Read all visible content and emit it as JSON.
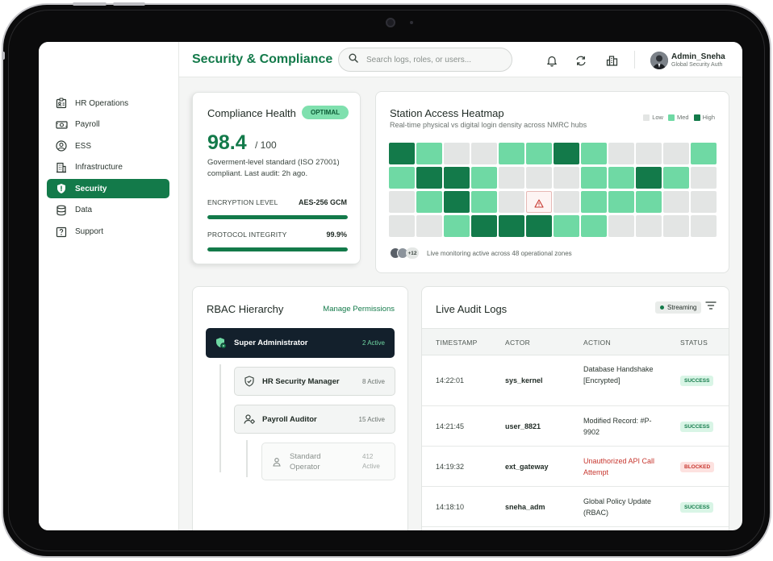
{
  "app": {
    "page_title": "Security & Compliance",
    "search_placeholder": "Search logs, roles, or users...",
    "user": {
      "name": "Admin_Sneha",
      "role": "Global Security Auth"
    }
  },
  "sidebar": {
    "items": [
      {
        "label": "HR Operations",
        "icon": "id-card-icon",
        "active": false
      },
      {
        "label": "Payroll",
        "icon": "money-icon",
        "active": false
      },
      {
        "label": "ESS",
        "icon": "user-circle-icon",
        "active": false
      },
      {
        "label": "Infrastructure",
        "icon": "building-icon",
        "active": false
      },
      {
        "label": "Security",
        "icon": "shield-icon",
        "active": true
      },
      {
        "label": "Data",
        "icon": "database-icon",
        "active": false
      },
      {
        "label": "Support",
        "icon": "help-icon",
        "active": false
      }
    ]
  },
  "header_icons": [
    "bell-icon",
    "sync-icon",
    "buildings-icon"
  ],
  "compliance": {
    "title": "Compliance Health",
    "badge": "OPTIMAL",
    "score": "98.4",
    "score_denominator": "/ 100",
    "description": "Goverment-level standard (ISO 27001) compliant. Last audit: 2h ago.",
    "metrics": [
      {
        "label": "ENCRYPTION LEVEL",
        "value": "AES-256 GCM",
        "fill": 1.0
      },
      {
        "label": "PROTOCOL INTEGRITY",
        "value": "99.9%",
        "fill": 0.999
      }
    ]
  },
  "heatmap": {
    "title": "Station Access Heatmap",
    "subtitle": "Real-time physical vs digital login density across NMRC hubs",
    "legend": [
      {
        "label": "Low",
        "color": "#e3e5e4"
      },
      {
        "label": "Med",
        "color": "#6fd9a4"
      },
      {
        "label": "High",
        "color": "#137a4a"
      }
    ],
    "levels": [
      [
        3,
        2,
        1,
        1,
        2,
        2,
        3,
        2,
        1,
        1,
        1,
        2
      ],
      [
        2,
        3,
        3,
        2,
        1,
        1,
        1,
        2,
        2,
        3,
        2,
        1
      ],
      [
        1,
        2,
        3,
        2,
        1,
        0,
        1,
        2,
        2,
        2,
        1,
        1
      ],
      [
        1,
        1,
        2,
        3,
        3,
        3,
        2,
        2,
        1,
        1,
        1,
        1
      ]
    ],
    "alert_icon": "warning-icon",
    "footer_count": "+12",
    "footer_text": "Live monitoring active across 48 operational zones"
  },
  "rbac": {
    "title": "RBAC Hierarchy",
    "manage_link": "Manage Permissions",
    "roles": [
      {
        "name": "Super Administrator",
        "count": "2 Active",
        "icon": "shield-user-icon"
      },
      {
        "name": "HR Security Manager",
        "count": "8 Active",
        "icon": "shield-check-icon"
      },
      {
        "name": "Payroll Auditor",
        "count": "15 Active",
        "icon": "user-gear-icon"
      },
      {
        "name": "Standard Operator",
        "count": "412 Active",
        "icon": "user-icon"
      }
    ]
  },
  "audit": {
    "title": "Live Audit Logs",
    "stream_label": "Streaming",
    "columns": [
      "TIMESTAMP",
      "ACTOR",
      "ACTION",
      "STATUS"
    ],
    "rows": [
      {
        "time": "14:22:01",
        "actor": "sys_kernel",
        "action": "Database Handshake [Encrypted]",
        "status": "SUCCESS",
        "danger": false
      },
      {
        "time": "14:21:45",
        "actor": "user_8821",
        "action": "Modified Record: #P-9902",
        "status": "SUCCESS",
        "danger": false
      },
      {
        "time": "14:19:32",
        "actor": "ext_gateway",
        "action": "Unauthorized API Call Attempt",
        "status": "BLOCKED",
        "danger": true
      },
      {
        "time": "14:18:10",
        "actor": "sneha_adm",
        "action": "Global Policy Update (RBAC)",
        "status": "SUCCESS",
        "danger": false
      }
    ]
  },
  "colors": {
    "brand": "#137a4a",
    "brand_light": "#6fd9a4",
    "danger": "#c7372f",
    "dark": "#13202c"
  }
}
